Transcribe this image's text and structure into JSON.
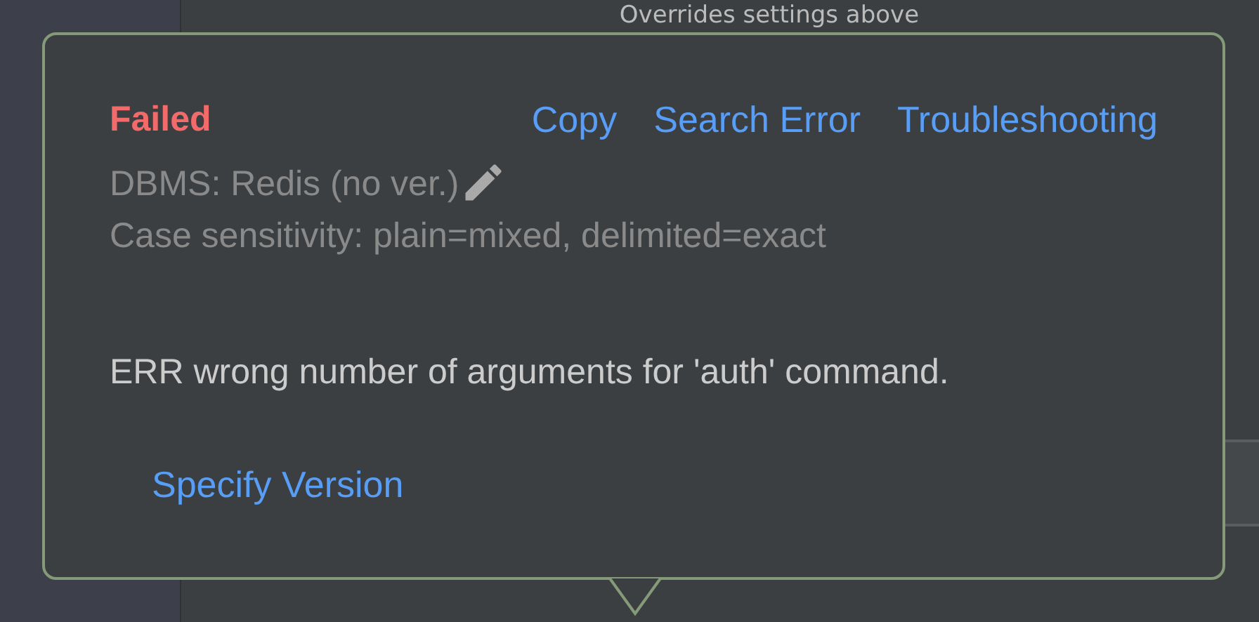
{
  "background": {
    "hint": "Overrides settings above"
  },
  "popup": {
    "status": "Failed",
    "actions": [
      {
        "label": "Copy"
      },
      {
        "label": "Search Error"
      },
      {
        "label": "Troubleshooting"
      }
    ],
    "dbms": "DBMS: Redis (no ver.)",
    "case_sensitivity": "Case sensitivity: plain=mixed, delimited=exact",
    "message": "ERR wrong number of arguments for 'auth' command.",
    "link": "Specify Version"
  }
}
